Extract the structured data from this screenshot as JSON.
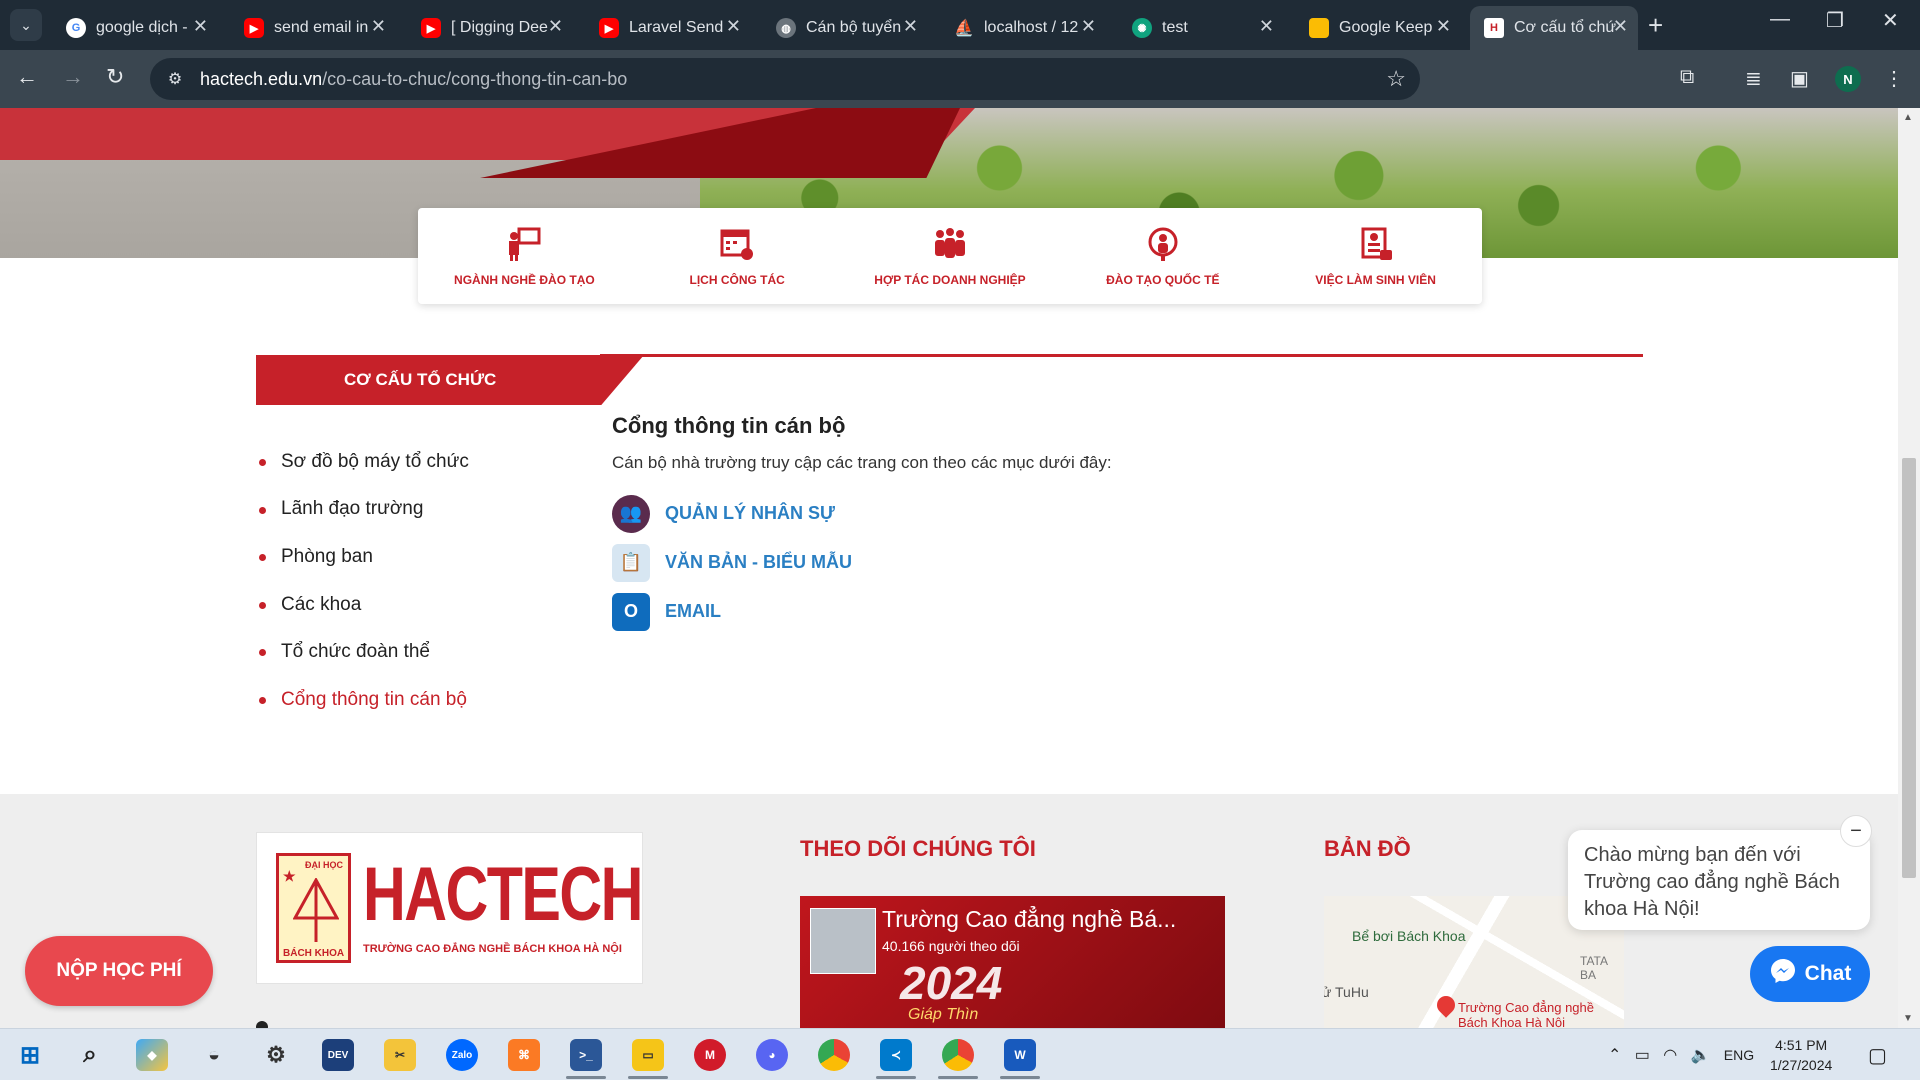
{
  "browser": {
    "tabs": [
      {
        "title": "google dịch - ",
        "icon": "google-icon",
        "color": "#4285f4"
      },
      {
        "title": "send email in",
        "icon": "youtube-icon",
        "color": "#ff0000"
      },
      {
        "title": "[ Digging Dee",
        "icon": "youtube-icon",
        "color": "#ff0000"
      },
      {
        "title": "Laravel Send",
        "icon": "youtube-icon",
        "color": "#ff0000"
      },
      {
        "title": "Cán bộ tuyển",
        "icon": "globe-icon",
        "color": "#888888"
      },
      {
        "title": "localhost / 12",
        "icon": "phpmyadmin-icon",
        "color": "#f29111"
      },
      {
        "title": "test",
        "icon": "chatgpt-icon",
        "color": "#10a37f"
      },
      {
        "title": "Google Keep",
        "icon": "keep-icon",
        "color": "#fbbc04"
      },
      {
        "title": "Cơ cấu tổ chứ",
        "icon": "hactech-icon",
        "color": "#c62129"
      }
    ],
    "url_host": "hactech.edu.vn",
    "url_path": "/co-cau-to-chuc/cong-thong-tin-can-bo",
    "profile_initial": "N"
  },
  "quicknav": [
    {
      "label": "NGÀNH NGHỀ ĐÀO TẠO",
      "icon": "teacher-icon"
    },
    {
      "label": "LỊCH CÔNG TÁC",
      "icon": "calendar-icon"
    },
    {
      "label": "HỢP TÁC DOANH NGHIỆP",
      "icon": "people-icon"
    },
    {
      "label": "ĐÀO TẠO QUỐC TẾ",
      "icon": "globe-person-icon"
    },
    {
      "label": "VIỆC LÀM SINH VIÊN",
      "icon": "job-icon"
    }
  ],
  "section": {
    "title": "CƠ CẤU TỔ CHỨC"
  },
  "sidemenu": [
    {
      "label": "Sơ đồ bộ máy tổ chức"
    },
    {
      "label": "Lãnh đạo trường"
    },
    {
      "label": "Phòng ban"
    },
    {
      "label": "Các khoa"
    },
    {
      "label": "Tổ chức đoàn thể"
    },
    {
      "label": "Cổng thông tin cán bộ"
    }
  ],
  "content": {
    "heading": "Cổng thông tin cán bộ",
    "intro": "Cán bộ nhà trường truy cập các trang con theo các mục dưới đây:",
    "links": [
      {
        "label": "QUẢN LÝ NHÂN SỰ",
        "icon": "hr-icon",
        "color": "#5a2b4d"
      },
      {
        "label": "VĂN BẢN - BIỂU MẪU",
        "icon": "document-icon",
        "color": "#d7e6f2"
      },
      {
        "label": "EMAIL",
        "icon": "outlook-icon",
        "color": "#0f6cbd"
      }
    ]
  },
  "footer": {
    "logo_name": "HACTECH",
    "logo_top": "ĐẠI HỌC",
    "logo_bottom": "BÁCH KHOA",
    "logo_sub": "TRƯỜNG CAO ĐẲNG NGHỀ BÁCH KHOA HÀ NỘI",
    "follow_title": "THEO DÕI CHÚNG TÔI",
    "map_title": "BẢN ĐỒ",
    "fb_page_name": "Trường Cao đẳng nghề Bá...",
    "fb_followers": "40.166 người theo dõi",
    "fb_year": "2024",
    "fb_caption": "Giáp Thìn",
    "map_labels": [
      "Bể bơi Bách Khoa",
      "ử TuHu",
      "Trường Cao đẳng nghề",
      "Bách Khoa Hà Nội",
      "TATA",
      "BA"
    ]
  },
  "floating": {
    "pay_label": "NỘP HỌC PHÍ",
    "chat_greeting": "Chào mừng bạn đến với Trường cao đẳng nghề Bách khoa Hà Nội!",
    "chat_label": "Chat"
  },
  "taskbar": {
    "apps": [
      "windows-icon",
      "search-icon",
      "cube-icon",
      "photos-icon",
      "settings-icon",
      "devc-icon",
      "snip-icon",
      "zalo-icon",
      "xampp-icon",
      "powershell-icon",
      "explorer-icon",
      "mendeley-icon",
      "discord-icon",
      "chrome-icon",
      "vscode-icon",
      "chrome-profile-icon",
      "word-icon"
    ],
    "lang": "ENG",
    "time": "4:51 PM",
    "date": "1/27/2024"
  }
}
